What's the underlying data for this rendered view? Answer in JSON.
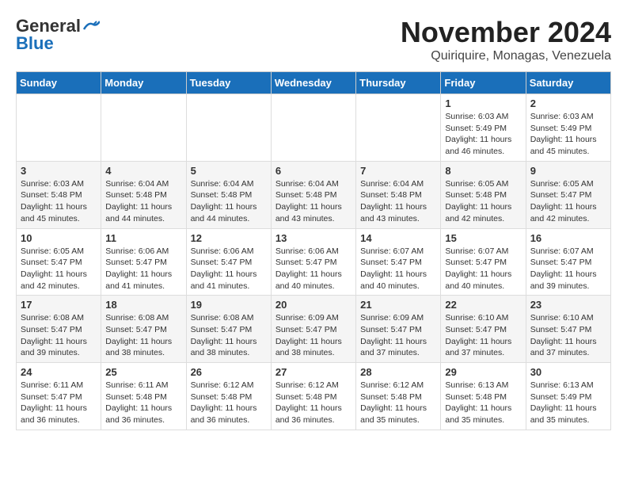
{
  "header": {
    "logo_line1": "General",
    "logo_line2": "Blue",
    "month": "November 2024",
    "location": "Quiriquire, Monagas, Venezuela"
  },
  "days_of_week": [
    "Sunday",
    "Monday",
    "Tuesday",
    "Wednesday",
    "Thursday",
    "Friday",
    "Saturday"
  ],
  "weeks": [
    [
      {
        "day": "",
        "content": ""
      },
      {
        "day": "",
        "content": ""
      },
      {
        "day": "",
        "content": ""
      },
      {
        "day": "",
        "content": ""
      },
      {
        "day": "",
        "content": ""
      },
      {
        "day": "1",
        "content": "Sunrise: 6:03 AM\nSunset: 5:49 PM\nDaylight: 11 hours\nand 46 minutes."
      },
      {
        "day": "2",
        "content": "Sunrise: 6:03 AM\nSunset: 5:49 PM\nDaylight: 11 hours\nand 45 minutes."
      }
    ],
    [
      {
        "day": "3",
        "content": "Sunrise: 6:03 AM\nSunset: 5:48 PM\nDaylight: 11 hours\nand 45 minutes."
      },
      {
        "day": "4",
        "content": "Sunrise: 6:04 AM\nSunset: 5:48 PM\nDaylight: 11 hours\nand 44 minutes."
      },
      {
        "day": "5",
        "content": "Sunrise: 6:04 AM\nSunset: 5:48 PM\nDaylight: 11 hours\nand 44 minutes."
      },
      {
        "day": "6",
        "content": "Sunrise: 6:04 AM\nSunset: 5:48 PM\nDaylight: 11 hours\nand 43 minutes."
      },
      {
        "day": "7",
        "content": "Sunrise: 6:04 AM\nSunset: 5:48 PM\nDaylight: 11 hours\nand 43 minutes."
      },
      {
        "day": "8",
        "content": "Sunrise: 6:05 AM\nSunset: 5:48 PM\nDaylight: 11 hours\nand 42 minutes."
      },
      {
        "day": "9",
        "content": "Sunrise: 6:05 AM\nSunset: 5:47 PM\nDaylight: 11 hours\nand 42 minutes."
      }
    ],
    [
      {
        "day": "10",
        "content": "Sunrise: 6:05 AM\nSunset: 5:47 PM\nDaylight: 11 hours\nand 42 minutes."
      },
      {
        "day": "11",
        "content": "Sunrise: 6:06 AM\nSunset: 5:47 PM\nDaylight: 11 hours\nand 41 minutes."
      },
      {
        "day": "12",
        "content": "Sunrise: 6:06 AM\nSunset: 5:47 PM\nDaylight: 11 hours\nand 41 minutes."
      },
      {
        "day": "13",
        "content": "Sunrise: 6:06 AM\nSunset: 5:47 PM\nDaylight: 11 hours\nand 40 minutes."
      },
      {
        "day": "14",
        "content": "Sunrise: 6:07 AM\nSunset: 5:47 PM\nDaylight: 11 hours\nand 40 minutes."
      },
      {
        "day": "15",
        "content": "Sunrise: 6:07 AM\nSunset: 5:47 PM\nDaylight: 11 hours\nand 40 minutes."
      },
      {
        "day": "16",
        "content": "Sunrise: 6:07 AM\nSunset: 5:47 PM\nDaylight: 11 hours\nand 39 minutes."
      }
    ],
    [
      {
        "day": "17",
        "content": "Sunrise: 6:08 AM\nSunset: 5:47 PM\nDaylight: 11 hours\nand 39 minutes."
      },
      {
        "day": "18",
        "content": "Sunrise: 6:08 AM\nSunset: 5:47 PM\nDaylight: 11 hours\nand 38 minutes."
      },
      {
        "day": "19",
        "content": "Sunrise: 6:08 AM\nSunset: 5:47 PM\nDaylight: 11 hours\nand 38 minutes."
      },
      {
        "day": "20",
        "content": "Sunrise: 6:09 AM\nSunset: 5:47 PM\nDaylight: 11 hours\nand 38 minutes."
      },
      {
        "day": "21",
        "content": "Sunrise: 6:09 AM\nSunset: 5:47 PM\nDaylight: 11 hours\nand 37 minutes."
      },
      {
        "day": "22",
        "content": "Sunrise: 6:10 AM\nSunset: 5:47 PM\nDaylight: 11 hours\nand 37 minutes."
      },
      {
        "day": "23",
        "content": "Sunrise: 6:10 AM\nSunset: 5:47 PM\nDaylight: 11 hours\nand 37 minutes."
      }
    ],
    [
      {
        "day": "24",
        "content": "Sunrise: 6:11 AM\nSunset: 5:47 PM\nDaylight: 11 hours\nand 36 minutes."
      },
      {
        "day": "25",
        "content": "Sunrise: 6:11 AM\nSunset: 5:48 PM\nDaylight: 11 hours\nand 36 minutes."
      },
      {
        "day": "26",
        "content": "Sunrise: 6:12 AM\nSunset: 5:48 PM\nDaylight: 11 hours\nand 36 minutes."
      },
      {
        "day": "27",
        "content": "Sunrise: 6:12 AM\nSunset: 5:48 PM\nDaylight: 11 hours\nand 36 minutes."
      },
      {
        "day": "28",
        "content": "Sunrise: 6:12 AM\nSunset: 5:48 PM\nDaylight: 11 hours\nand 35 minutes."
      },
      {
        "day": "29",
        "content": "Sunrise: 6:13 AM\nSunset: 5:48 PM\nDaylight: 11 hours\nand 35 minutes."
      },
      {
        "day": "30",
        "content": "Sunrise: 6:13 AM\nSunset: 5:49 PM\nDaylight: 11 hours\nand 35 minutes."
      }
    ]
  ]
}
